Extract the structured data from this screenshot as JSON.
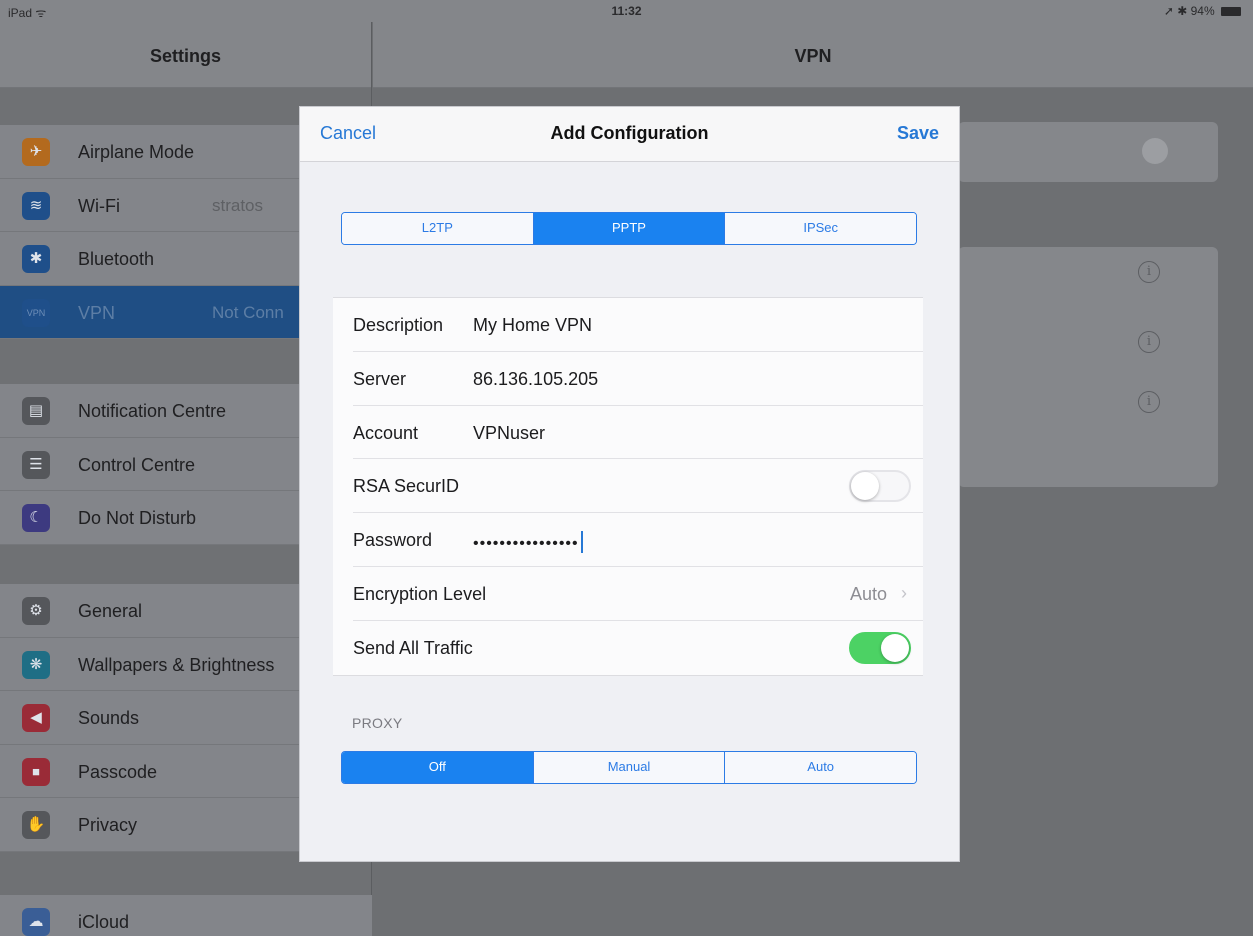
{
  "status_bar": {
    "device": "iPad ᯤ",
    "time": "11:32",
    "right": "➚ ✱ 94%"
  },
  "settings": {
    "title": "Settings",
    "groups": [
      [
        {
          "label": "Airplane Mode",
          "value": "",
          "icon": "airplane-icon",
          "glyph": "✈",
          "color": "#b36a1e"
        },
        {
          "label": "Wi-Fi",
          "value": "stratos",
          "icon": "wifi-icon",
          "glyph": "≋",
          "color": "#1f4f8a"
        },
        {
          "label": "Bluetooth",
          "value": "",
          "icon": "bluetooth-icon",
          "glyph": "✱",
          "color": "#1f4f8a"
        },
        {
          "label": "VPN",
          "value": "Not Conn",
          "icon": "vpn-icon",
          "glyph": "VPN",
          "color": "#1f4f8a",
          "active": true
        }
      ],
      [
        {
          "label": "Notification Centre",
          "value": "",
          "icon": "notification-centre-icon",
          "glyph": "▤",
          "color": "#55575b"
        },
        {
          "label": "Control Centre",
          "value": "",
          "icon": "control-centre-icon",
          "glyph": "☰",
          "color": "#55575b"
        },
        {
          "label": "Do Not Disturb",
          "value": "",
          "icon": "moon-icon",
          "glyph": "☾",
          "color": "#3d3a80"
        }
      ],
      [
        {
          "label": "General",
          "value": "",
          "icon": "gear-icon",
          "glyph": "⚙",
          "color": "#55575b"
        },
        {
          "label": "Wallpapers & Brightness",
          "value": "",
          "icon": "wallpaper-icon",
          "glyph": "❋",
          "color": "#1f6e85"
        },
        {
          "label": "Sounds",
          "value": "",
          "icon": "speaker-icon",
          "glyph": "◀",
          "color": "#9a2b37"
        },
        {
          "label": "Passcode",
          "value": "",
          "icon": "lock-icon",
          "glyph": "🔒",
          "color": "#9a2b37"
        },
        {
          "label": "Privacy",
          "value": "",
          "icon": "hand-icon",
          "glyph": "✋",
          "color": "#55575b"
        }
      ],
      [
        {
          "label": "iCloud",
          "value": "",
          "icon": "cloud-icon",
          "glyph": "☁",
          "color": "#3a5e96"
        }
      ]
    ]
  },
  "vpn": {
    "title": "VPN"
  },
  "modal": {
    "cancel": "Cancel",
    "title": "Add Configuration",
    "save": "Save",
    "type_segments": [
      "L2TP",
      "PPTP",
      "IPSec"
    ],
    "type_selected": "PPTP",
    "fields": {
      "description_label": "Description",
      "description_value": "My Home VPN",
      "server_label": "Server",
      "server_value": "86.136.105.205",
      "account_label": "Account",
      "account_value": "VPNuser",
      "rsa_label": "RSA SecurID",
      "rsa_on": false,
      "password_label": "Password",
      "password_value": "••••••••••••••••",
      "encryption_label": "Encryption Level",
      "encryption_value": "Auto",
      "send_all_label": "Send All Traffic",
      "send_all_on": true
    },
    "proxy_label": "PROXY",
    "proxy_segments": [
      "Off",
      "Manual",
      "Auto"
    ],
    "proxy_selected": "Off"
  }
}
